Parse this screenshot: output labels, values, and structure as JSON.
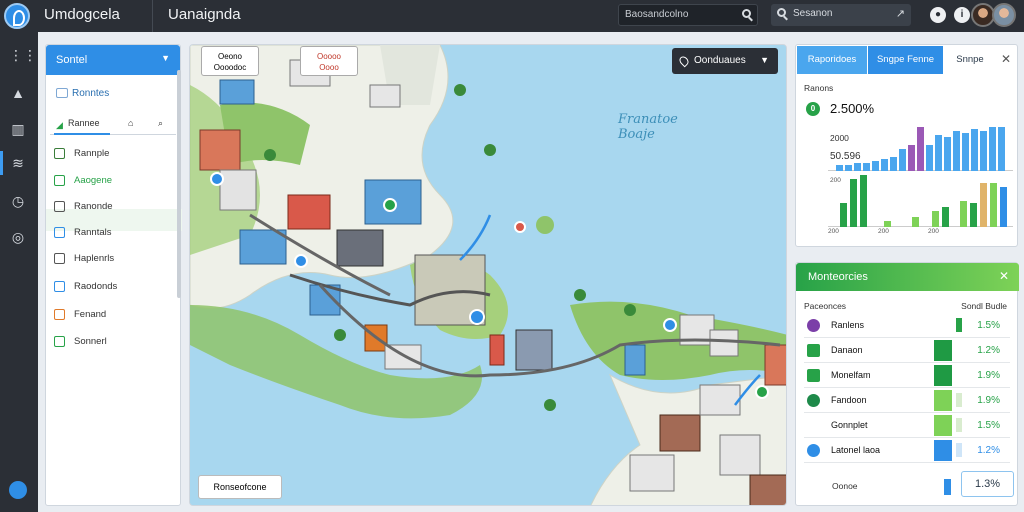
{
  "app": {
    "title": "Umdogcela",
    "page_title": "Uanaignda",
    "search_left": "Baosandcolno",
    "search_right": "Sesanon"
  },
  "left_panel": {
    "header": "Sontel",
    "sub_item": "Ronntes",
    "tabs": [
      "Rannee"
    ],
    "items": [
      "Rannple",
      "Aaogene",
      "Ranonde",
      "Ranntals",
      "Haplenrls",
      "Raodonds",
      "Fenand",
      "Sonnerl"
    ]
  },
  "map": {
    "top_button": "Oonduaues",
    "water_label_1": "Franatoe",
    "water_label_2": "Boaje",
    "callout_1": [
      "Oeono",
      "Oooodoc"
    ],
    "callout_2": [
      "Ooooo",
      "Oooo"
    ],
    "bottom_button": "Ronseofcone"
  },
  "right_panel_1": {
    "tabs": [
      "Raporidoes",
      "Sngpe Fenne",
      "Snnpe"
    ],
    "kpi_label": "Ranons",
    "kpi_value": "2.500%",
    "kpi_icon": "0",
    "value_1": "2000",
    "value_2": "50.596",
    "y_ticks_top": "200",
    "chart_labels": [
      "200",
      "200",
      "200"
    ]
  },
  "right_panel_2": {
    "header": "Monteorcies",
    "col_left": "Paceonces",
    "col_right": "Sondl Budle",
    "rows": [
      {
        "name": "Ranlens",
        "pct": "1.5%",
        "color": "#7b3fa8",
        "icon": "G"
      },
      {
        "name": "Danaon",
        "pct": "1.2%",
        "color": "#27a248",
        "icon": ""
      },
      {
        "name": "Monelfam",
        "pct": "1.9%",
        "color": "#27a248",
        "icon": ""
      },
      {
        "name": "Fandoon",
        "pct": "1.9%",
        "color": "#1e8a4a",
        "icon": ""
      },
      {
        "name": "Gonnplet",
        "pct": "1.5%",
        "color": "#ffffff",
        "icon": ""
      },
      {
        "name": "Latonel laoa",
        "pct": "1.2%",
        "color": "#2f8ee6",
        "icon": "G"
      }
    ],
    "footer_label": "Oonoe",
    "footer_value": "1.3%"
  }
}
